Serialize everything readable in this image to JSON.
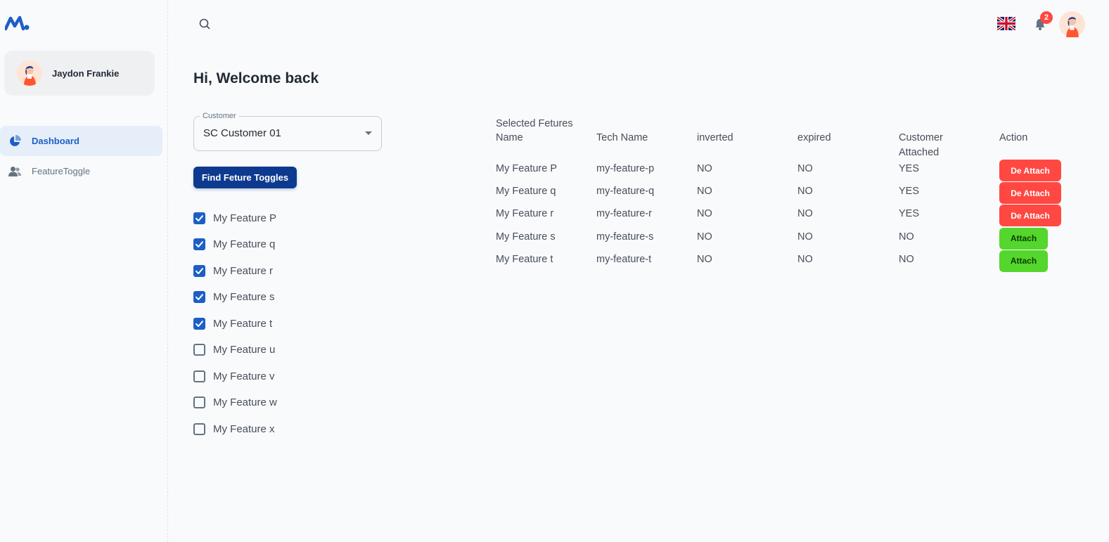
{
  "user": {
    "name": "Jaydon Frankie"
  },
  "sidebar": {
    "items": [
      {
        "label": "Dashboard",
        "icon": "pie-chart-icon",
        "active": true
      },
      {
        "label": "FeatureToggle",
        "icon": "users-icon",
        "active": false
      }
    ]
  },
  "topbar": {
    "notification_count": "2",
    "language_icon": "uk-flag-icon"
  },
  "main": {
    "welcome": "Hi, Welcome back",
    "customer_select": {
      "label": "Customer",
      "value": "SC Customer 01"
    },
    "find_button": "Find Feture Toggles",
    "features": [
      {
        "label": "My Feature P",
        "checked": true
      },
      {
        "label": "My Feature q",
        "checked": true
      },
      {
        "label": "My Feature r",
        "checked": true
      },
      {
        "label": "My Feature s",
        "checked": true
      },
      {
        "label": "My Feature t",
        "checked": true
      },
      {
        "label": "My Feature u",
        "checked": false
      },
      {
        "label": "My Feature v",
        "checked": false
      },
      {
        "label": "My Feature w",
        "checked": false
      },
      {
        "label": "My Feature x",
        "checked": false
      }
    ]
  },
  "table": {
    "title": "Selected Fetures",
    "headers": {
      "name": "Name",
      "tech_name": "Tech Name",
      "inverted": "inverted",
      "expired": "expired",
      "customer_attached": "Customer Attached",
      "action": "Action"
    },
    "rows": [
      {
        "name": "My Feature P",
        "tech_name": "my-feature-p",
        "inverted": "NO",
        "expired": "NO",
        "customer_attached": "YES",
        "action": "De Attach"
      },
      {
        "name": "My Feature q",
        "tech_name": "my-feature-q",
        "inverted": "NO",
        "expired": "NO",
        "customer_attached": "YES",
        "action": "De Attach"
      },
      {
        "name": "My Feature r",
        "tech_name": "my-feature-r",
        "inverted": "NO",
        "expired": "NO",
        "customer_attached": "YES",
        "action": "De Attach"
      },
      {
        "name": "My Feature s",
        "tech_name": "my-feature-s",
        "inverted": "NO",
        "expired": "NO",
        "customer_attached": "NO",
        "action": "Attach"
      },
      {
        "name": "My Feature t",
        "tech_name": "my-feature-t",
        "inverted": "NO",
        "expired": "NO",
        "customer_attached": "NO",
        "action": "Attach"
      }
    ]
  },
  "colors": {
    "primary": "#1c5fc7",
    "find_button": "#0d3a8f",
    "detach": "#ff4842",
    "attach": "#54d62c"
  }
}
